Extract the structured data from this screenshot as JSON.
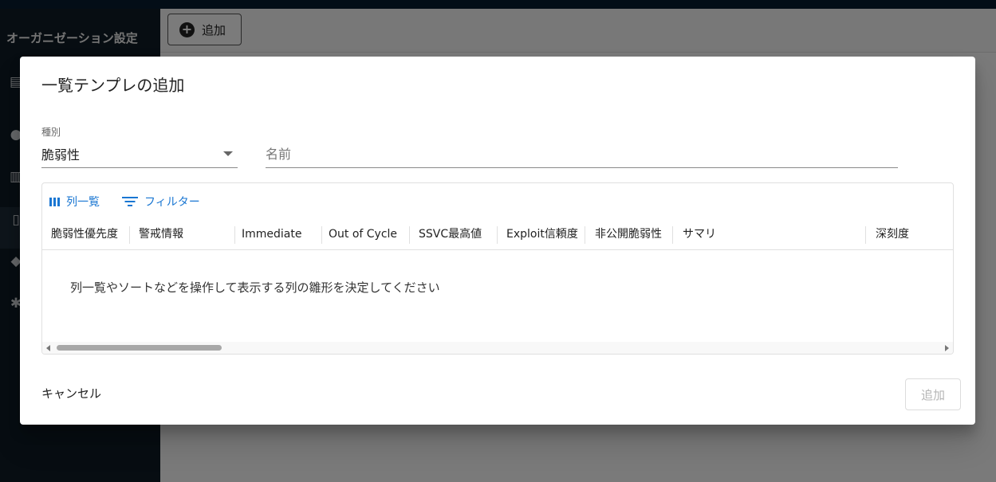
{
  "sidebar": {
    "org_title": "オーガニゼーション設定"
  },
  "main": {
    "add_label": "追加"
  },
  "dialog": {
    "title": "一覧テンプレの追加",
    "type_label": "種別",
    "type_value": "脆弱性",
    "name_placeholder": "名前",
    "toolbar": {
      "columns_label": "列一覧",
      "filter_label": "フィルター"
    },
    "columns": [
      "脆弱性優先度",
      "警戒情報",
      "Immediate",
      "Out of Cycle",
      "SSVC最高値",
      "Exploit信頼度",
      "非公開脆弱性",
      "サマリ",
      "深刻度"
    ],
    "empty_message": "列一覧やソートなどを操作して表示する列の雛形を決定してください",
    "cancel_label": "キャンセル",
    "submit_label": "追加"
  },
  "colors": {
    "primary": "#1976d2",
    "sidebar_bg": "#0f1a24",
    "topbar_bg": "#061a2e"
  }
}
